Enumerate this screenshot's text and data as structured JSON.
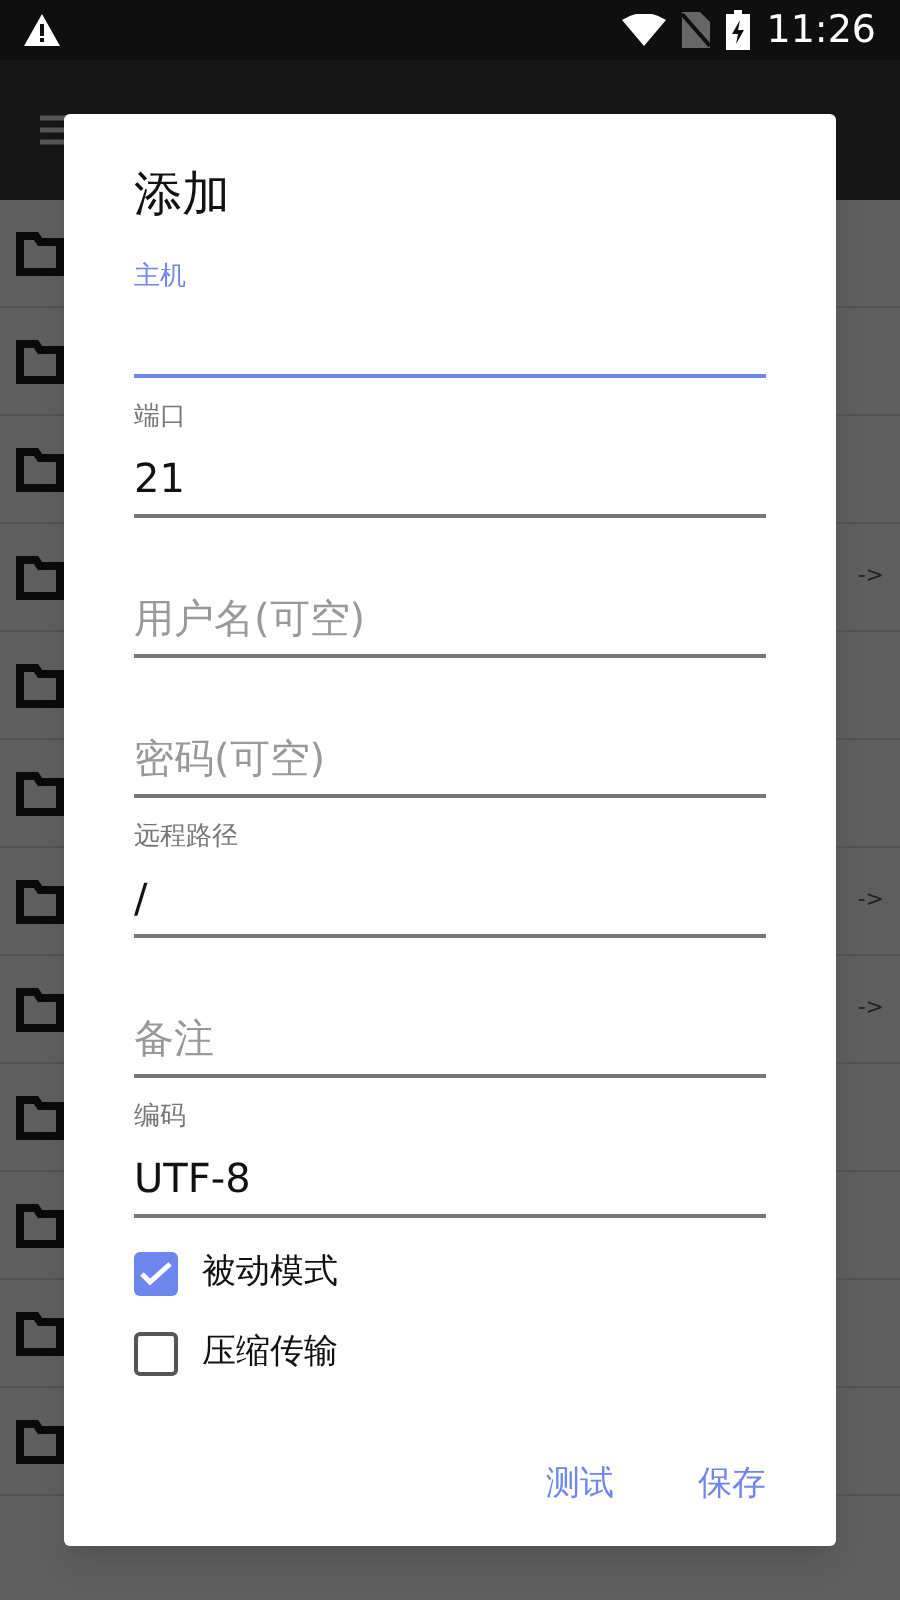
{
  "status_bar": {
    "time": "11:26"
  },
  "background_rows": [
    {},
    {},
    {},
    {
      "arrow": "->"
    },
    {},
    {},
    {
      "arrow": "->"
    },
    {
      "arrow": "->"
    },
    {},
    {},
    {},
    {}
  ],
  "dialog": {
    "title": "添加",
    "fields": [
      {
        "label": "主机",
        "focused": true
      },
      {
        "label": "端口",
        "value": "21",
        "focused": false
      },
      {
        "placeholder": "用户名(可空)",
        "focused": false
      },
      {
        "placeholder": "密码(可空)",
        "focused": false
      },
      {
        "label": "远程路径",
        "value": "/",
        "focused": false
      },
      {
        "placeholder": "备注",
        "focused": false
      },
      {
        "label": "编码",
        "value": "UTF-8",
        "focused": false
      }
    ],
    "checkboxes": [
      {
        "label": "被动模式",
        "checked": true
      },
      {
        "label": "压缩传输",
        "checked": false
      }
    ],
    "buttons": [
      "测试",
      "保存"
    ]
  }
}
